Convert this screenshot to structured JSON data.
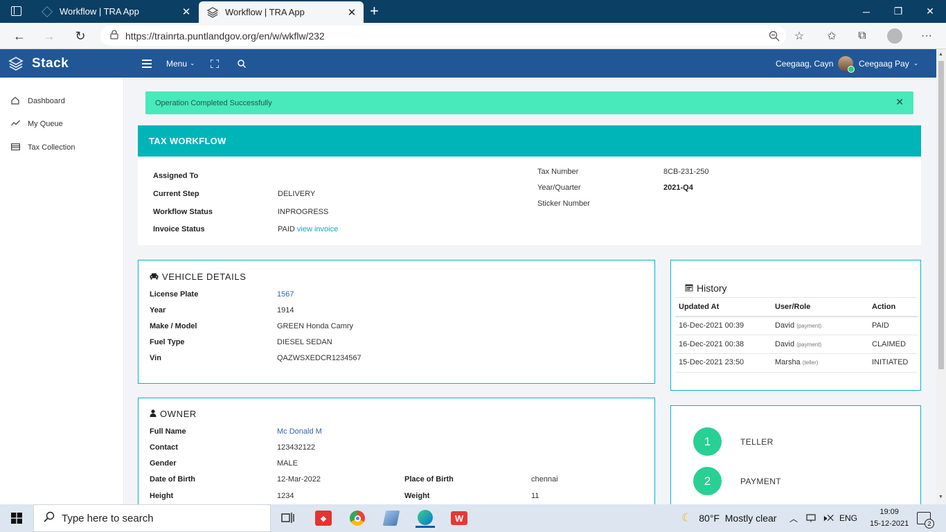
{
  "browser": {
    "tabs": [
      {
        "title": "Workflow | TRA App",
        "active": false
      },
      {
        "title": "Workflow | TRA App",
        "active": true
      }
    ],
    "url": "https://trainrta.puntlandgov.org/en/w/wkflw/232"
  },
  "header": {
    "brand": "Stack",
    "menu_label": "Menu",
    "org_name": "Ceegaag, Cayn",
    "user_name": "Ceegaag Pay"
  },
  "sidebar": {
    "items": [
      {
        "label": "Dashboard",
        "icon": "home-icon"
      },
      {
        "label": "My Queue",
        "icon": "trend-icon"
      },
      {
        "label": "Tax Collection",
        "icon": "card-icon"
      }
    ]
  },
  "alert": {
    "message": "Operation Completed Successfully"
  },
  "tax_workflow": {
    "title": "TAX WORKFLOW",
    "assigned_to_label": "Assigned To",
    "assigned_to_value": "",
    "current_step_label": "Current Step",
    "current_step_value": "DELIVERY",
    "workflow_status_label": "Workflow Status",
    "workflow_status_value": "INPROGRESS",
    "invoice_status_label": "Invoice Status",
    "invoice_status_value": "PAID",
    "invoice_link": "view invoice",
    "tax_number_label": "Tax Number",
    "tax_number_value": "8CB-231-250",
    "year_quarter_label": "Year/Quarter",
    "year_quarter_value": "2021-Q4",
    "sticker_number_label": "Sticker Number",
    "sticker_number_value": ""
  },
  "vehicle": {
    "title": "VEHICLE DETAILS",
    "fields": [
      {
        "label": "License Plate",
        "value": "1567"
      },
      {
        "label": "Year",
        "value": "1914"
      },
      {
        "label": "Make / Model",
        "value": "GREEN Honda Camry"
      },
      {
        "label": "Fuel Type",
        "value": "DIESEL SEDAN"
      },
      {
        "label": "Vin",
        "value": "QAZWSXEDCR1234567"
      }
    ]
  },
  "owner": {
    "title": "OWNER",
    "fields": [
      {
        "label": "Full Name",
        "value": "Mc Donald M"
      },
      {
        "label": "Contact",
        "value": "123432122"
      },
      {
        "label": "Gender",
        "value": "MALE"
      },
      {
        "label": "Date of Birth",
        "value": "12-Mar-2022"
      },
      {
        "label": "Height",
        "value": "1234"
      }
    ],
    "extra": [
      {
        "label": "Place of Birth",
        "value": "chennai"
      },
      {
        "label": "Weight",
        "value": "11"
      }
    ]
  },
  "history": {
    "title": "History",
    "columns": [
      "Updated At",
      "User/Role",
      "Action"
    ],
    "rows": [
      {
        "updated_at": "16-Dec-2021 00:39",
        "user": "David",
        "role": "(payment)",
        "action": "PAID"
      },
      {
        "updated_at": "16-Dec-2021 00:38",
        "user": "David",
        "role": "(payment)",
        "action": "CLAIMED"
      },
      {
        "updated_at": "15-Dec-2021 23:50",
        "user": "Marsha",
        "role": "(teller)",
        "action": "INITIATED"
      }
    ]
  },
  "steps": [
    {
      "number": "1",
      "label": "TELLER"
    },
    {
      "number": "2",
      "label": "PAYMENT"
    }
  ],
  "taskbar": {
    "search_placeholder": "Type here to search",
    "weather": "80°F  Mostly clear",
    "language": "ENG",
    "time": "19:09",
    "date": "15-12-2021",
    "notifications": "2"
  },
  "colors": {
    "header_blue": "#215797",
    "teal": "#00b5b8",
    "alert_green": "#48e9bb",
    "step_green": "#28d094"
  }
}
